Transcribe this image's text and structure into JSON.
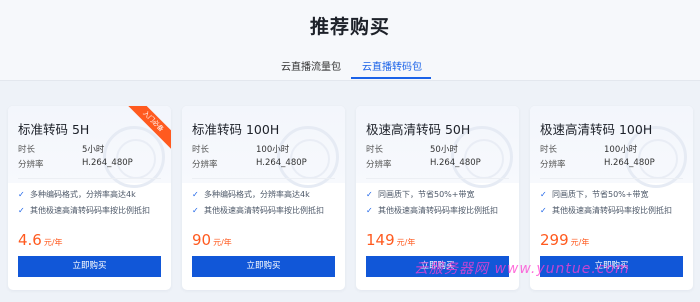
{
  "page": {
    "title": "推荐购买"
  },
  "tabs": [
    {
      "label": "云直播流量包",
      "active": false
    },
    {
      "label": "云直播转码包",
      "active": true
    }
  ],
  "labels": {
    "duration": "时长",
    "resolution": "分辨率",
    "price_unit": "元/年",
    "buy": "立即购买",
    "hot_badge": "入门必备"
  },
  "cards": [
    {
      "name": "标准转码 5H",
      "duration": "5小时",
      "resolution": "H.264_480P",
      "features": [
        "多种编码格式，分辨率高达4k",
        "其他极速高清转码码率按比例抵扣"
      ],
      "price": "4.6",
      "badge": true
    },
    {
      "name": "标准转码 100H",
      "duration": "100小时",
      "resolution": "H.264_480P",
      "features": [
        "多种编码格式，分辨率高达4k",
        "其他极速高清转码码率按比例抵扣"
      ],
      "price": "90",
      "badge": false
    },
    {
      "name": "极速高清转码 50H",
      "duration": "50小时",
      "resolution": "H.264_480P",
      "features": [
        "同画质下，节省50%+带宽",
        "其他极速高清转码码率按比例抵扣"
      ],
      "price": "149",
      "badge": false
    },
    {
      "name": "极速高清转码 100H",
      "duration": "100小时",
      "resolution": "H.264_480P",
      "features": [
        "同画质下，节省50%+带宽",
        "其他极速高清转码码率按比例抵扣"
      ],
      "price": "299",
      "badge": false
    }
  ],
  "watermark": "云服务器网 www.yuntue.com",
  "colors": {
    "accent": "#1a62e8",
    "price": "#ff5a1f",
    "button": "#1157d8"
  },
  "icons": {
    "feature_check": "check-icon"
  }
}
